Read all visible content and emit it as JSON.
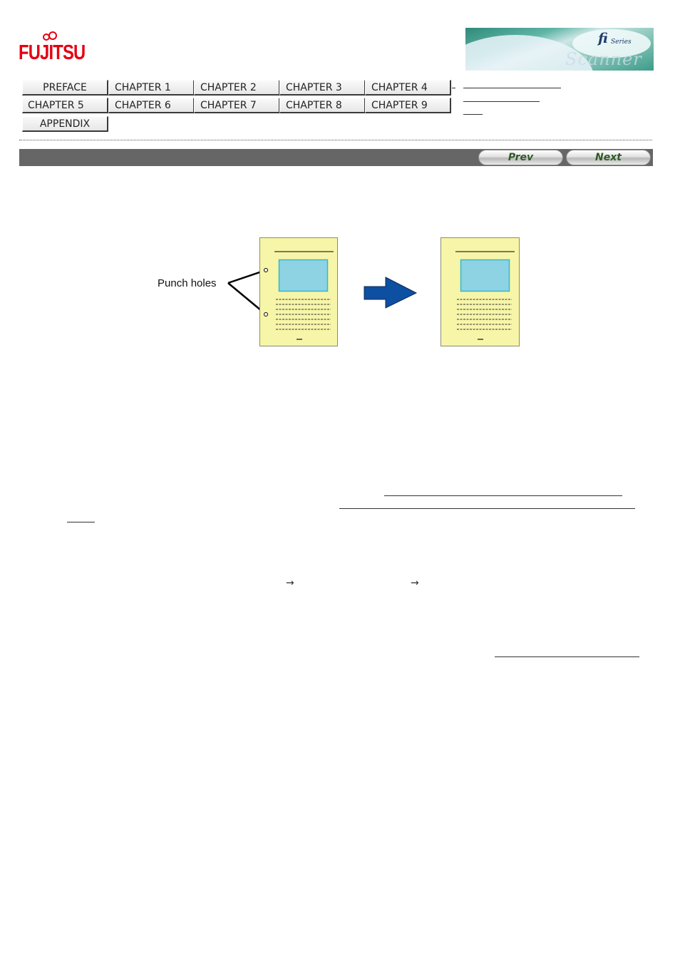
{
  "header": {
    "logo_text": "FUJITSU",
    "banner": {
      "brand_mark": "fi",
      "brand_sub": "Series",
      "caption": "Scanner"
    }
  },
  "nav": {
    "rows": [
      [
        "PREFACE",
        "CHAPTER 1",
        "CHAPTER 2",
        "CHAPTER 3",
        "CHAPTER 4"
      ],
      [
        "CHAPTER 5",
        "CHAPTER 6",
        "CHAPTER 7",
        "CHAPTER 8",
        "CHAPTER 9"
      ],
      [
        "APPENDIX"
      ]
    ],
    "side_links": [
      "",
      "",
      ""
    ]
  },
  "pager": {
    "prev_label": "Prev",
    "next_label": "Next"
  },
  "figure": {
    "callout_label": "Punch holes",
    "colors": {
      "page_fill": "#f7f5a8",
      "page_stroke": "#8c8c6e",
      "image_fill": "#8dd3e3",
      "image_stroke": "#37b7c8",
      "arrow_fill": "#0d4fa0"
    }
  },
  "body": {
    "links": [
      "",
      "",
      "",
      ""
    ],
    "arrows": [
      "→",
      "→"
    ]
  }
}
